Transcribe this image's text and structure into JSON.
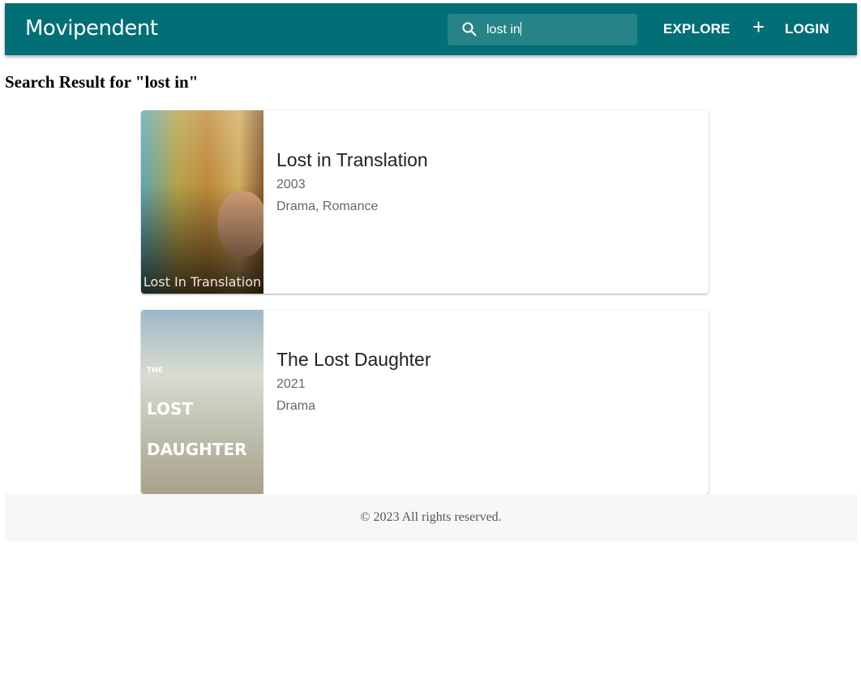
{
  "header": {
    "logo": "Movipendent",
    "search_value": "lost in",
    "explore": "EXPLORE",
    "add_icon": "plus-icon",
    "login": "LOGIN"
  },
  "page_title": "Search Result for \"lost in\"",
  "results": [
    {
      "title": "Lost in Translation",
      "year": "2003",
      "genres": "Drama, Romance",
      "poster_text": "Lost In Translation"
    },
    {
      "title": "The Lost Daughter",
      "year": "2021",
      "genres": "Drama",
      "poster_text": [
        "THE",
        "LOST",
        "DAUGHTER"
      ]
    }
  ],
  "footer": "© 2023 All rights reserved.",
  "colors": {
    "appbar": "#026e75",
    "search_bg": "#268489",
    "footer_bg": "#f6f7f9"
  }
}
